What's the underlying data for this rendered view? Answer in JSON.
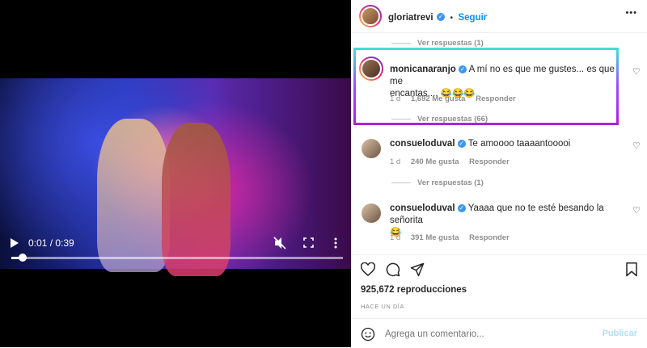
{
  "video": {
    "time_current": "0:01",
    "time_total": "0:39",
    "time_separator": " / ",
    "progress_fraction": 0.035,
    "icons": [
      "play-icon",
      "mute-icon",
      "fullscreen-icon",
      "more-vertical-icon"
    ]
  },
  "header": {
    "username": "gloriatrevi",
    "verified_mark": "✓",
    "dot": "•",
    "follow_label": "Seguir",
    "more_label": "•••"
  },
  "comments": [
    {
      "reply_toggle_above": "Ver respuestas (1)"
    },
    {
      "username": "monicanaranjo",
      "text_line1": "A mí no es que me gustes... es que me",
      "text_line2": "encantas.... 😂😂😂",
      "age": "1 d",
      "likes": "1,692 Me gusta",
      "reply_label": "Responder",
      "replies_link": "Ver respuestas (66)"
    },
    {
      "username": "consueloduval",
      "text_line1": "Te amoooo taaaantooooi",
      "age": "1 d",
      "likes": "240 Me gusta",
      "reply_label": "Responder",
      "replies_link": "Ver respuestas (1)"
    },
    {
      "username": "consueloduval",
      "text_line1": "Yaaaa que no te esté besando la señorita",
      "text_line2": "😂",
      "age": "1 d",
      "likes": "391 Me gusta",
      "reply_label": "Responder"
    }
  ],
  "actions": {
    "icons": [
      "heart-icon",
      "comment-icon",
      "share-icon",
      "bookmark-icon"
    ],
    "views": "925,672 reproducciones",
    "date": "HACE UN DÍA"
  },
  "compose": {
    "placeholder": "Agrega un comentario...",
    "publish_label": "Publicar"
  },
  "colors": {
    "accent": "#0095f6",
    "highlight_top": "#40e0d0",
    "highlight_bottom": "#b020e0"
  }
}
